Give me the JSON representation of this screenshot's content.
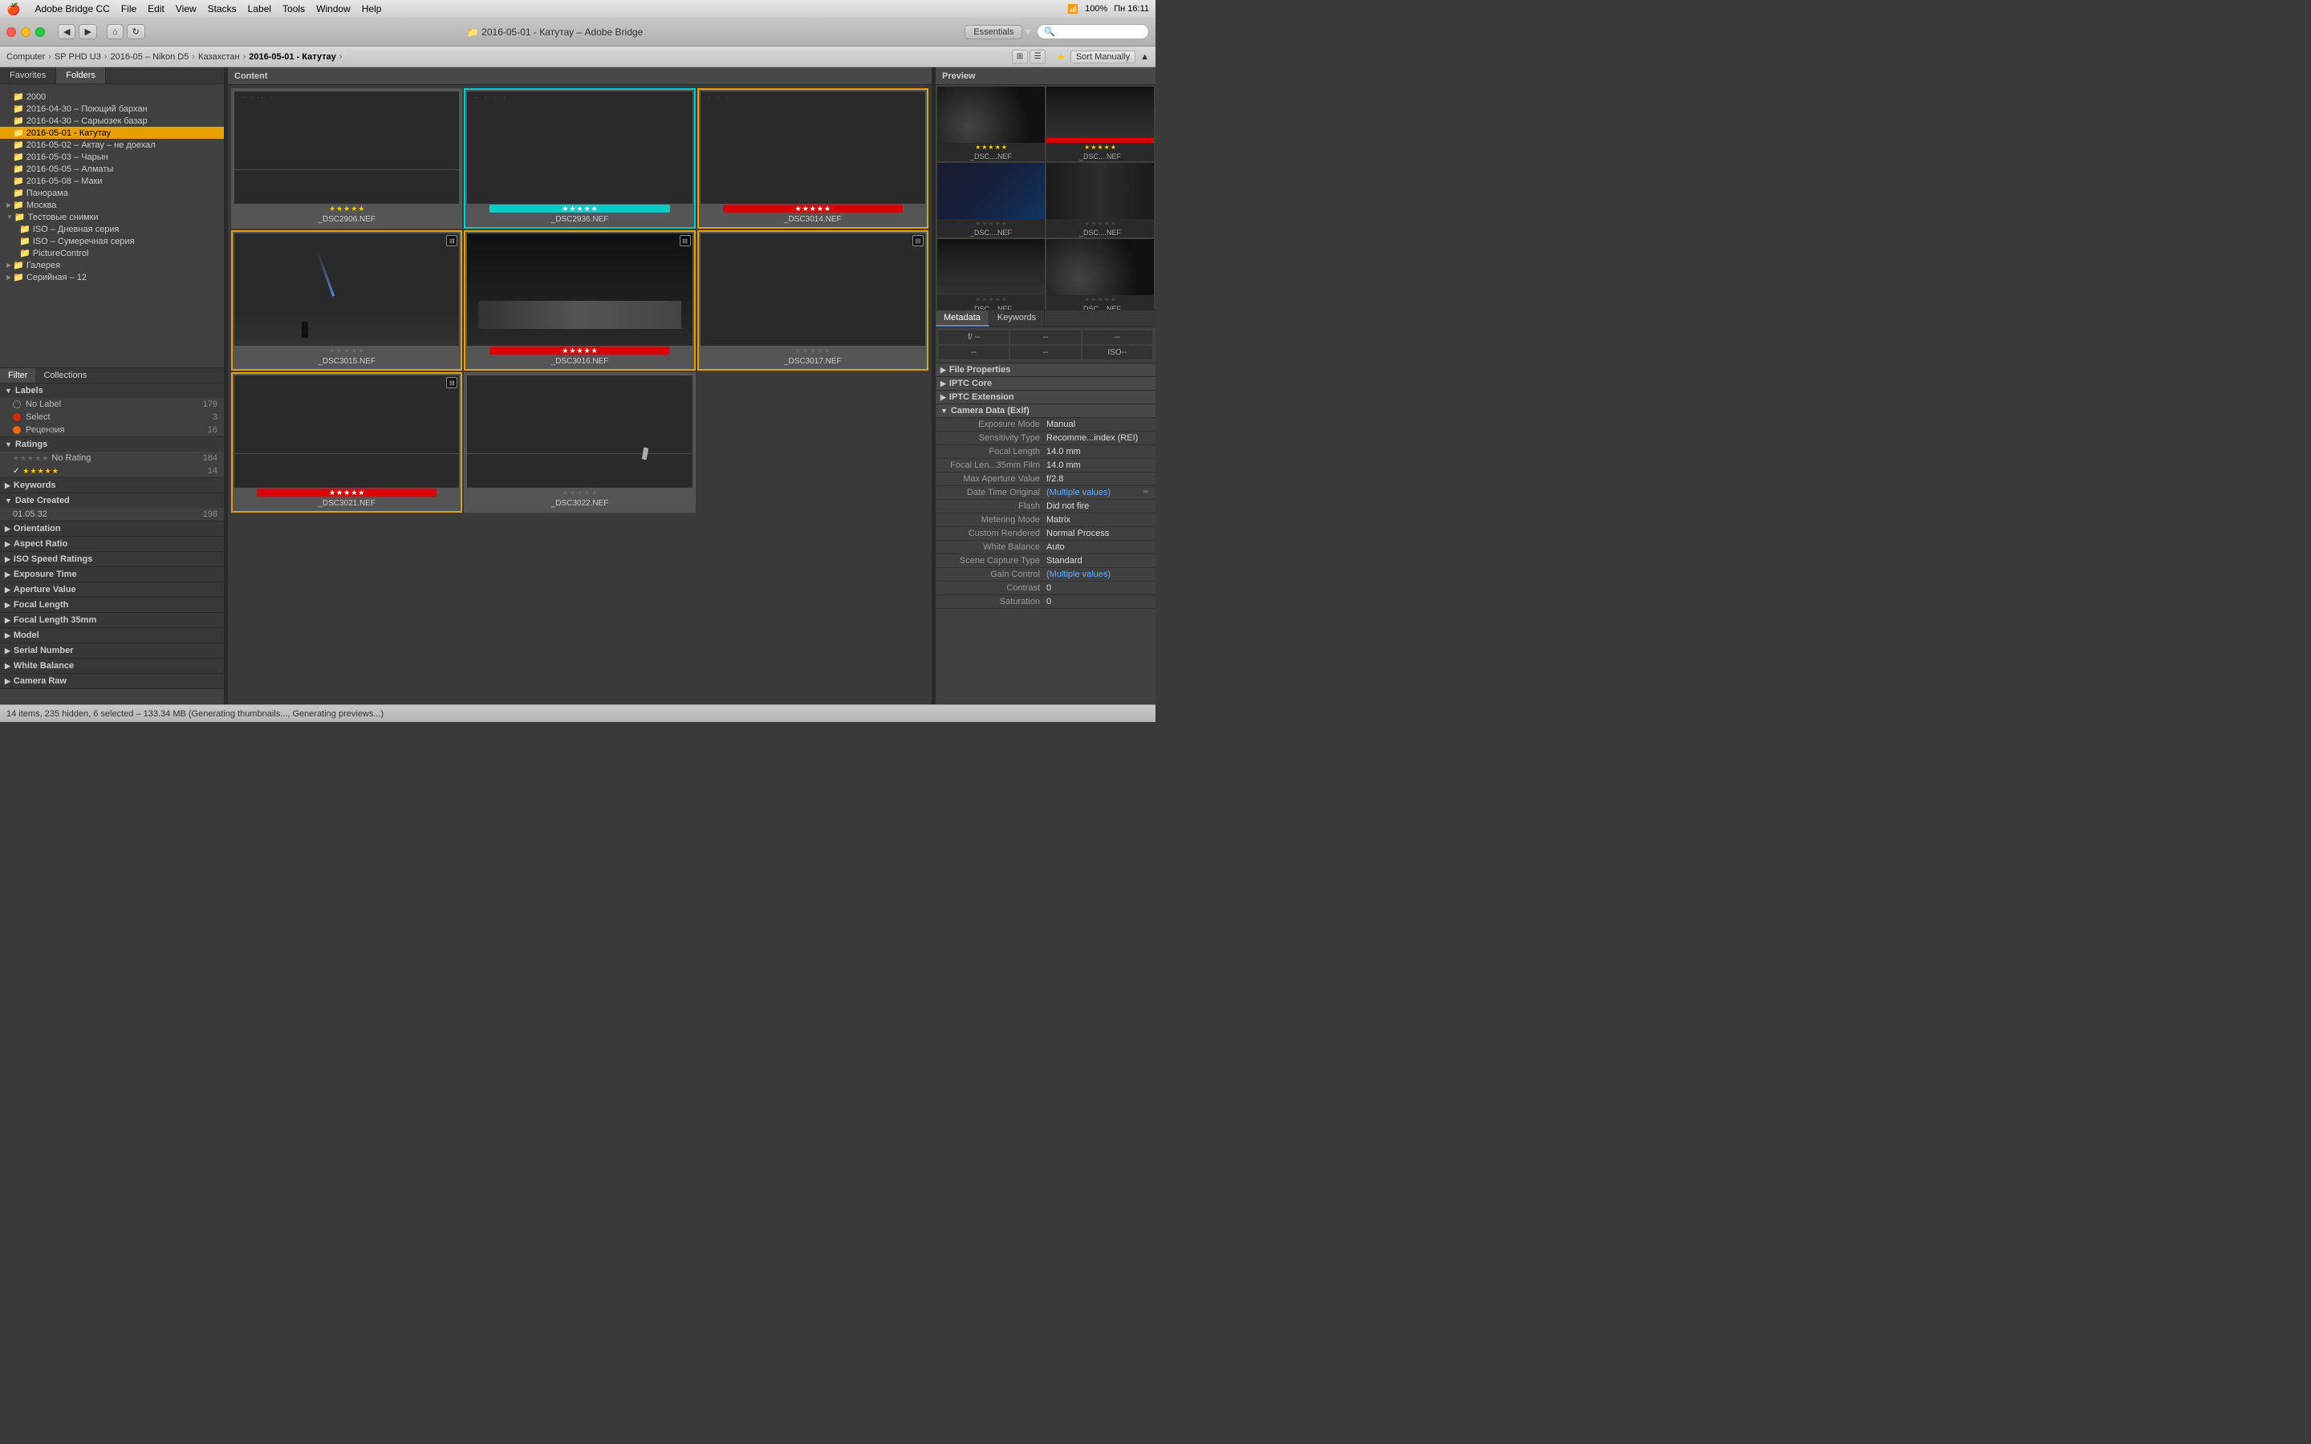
{
  "menubar": {
    "apple": "🍎",
    "app_name": "Adobe Bridge CC",
    "menus": [
      "File",
      "Edit",
      "View",
      "Stacks",
      "Label",
      "Tools",
      "Window",
      "Help"
    ],
    "right": "Пн 16:11",
    "battery": "100%"
  },
  "titlebar": {
    "title": "📁 2016-05-01 - Катутау – Adobe Bridge",
    "back": "◀",
    "forward": "▶"
  },
  "toolbar": {
    "essentials": "Essentials",
    "sort": "Sort Manually"
  },
  "breadcrumb": {
    "items": [
      "Computer",
      "SP PHD U3",
      "2016-05 – Nikon D5",
      "Казахстан",
      "2016-05-01 - Катутау"
    ]
  },
  "panels": {
    "left": {
      "tabs": [
        "Favorites",
        "Folders"
      ],
      "active_tab": "Folders",
      "tree": [
        {
          "label": "2000",
          "indent": 2,
          "icon": "📁"
        },
        {
          "label": "2016-04-30 – Поющий бархан",
          "indent": 2,
          "icon": "📁"
        },
        {
          "label": "2016-04-30 – Сарыозек базар",
          "indent": 2,
          "icon": "📁"
        },
        {
          "label": "2016-05-01 - Катутау",
          "indent": 2,
          "icon": "📁",
          "selected": true
        },
        {
          "label": "2016-05-02 – Актау – не доехал",
          "indent": 2,
          "icon": "📁"
        },
        {
          "label": "2016-05-03 – Чарын",
          "indent": 2,
          "icon": "📁"
        },
        {
          "label": "2016-05-05 – Алматы",
          "indent": 2,
          "icon": "📁"
        },
        {
          "label": "2016-05-08 – Маки",
          "indent": 2,
          "icon": "📁"
        },
        {
          "label": "Панорама",
          "indent": 2,
          "icon": "📁"
        },
        {
          "label": "Москва",
          "indent": 1,
          "icon": "📁"
        },
        {
          "label": "Тестовые снимки",
          "indent": 1,
          "icon": "📁",
          "expanded": true
        },
        {
          "label": "ISO – Дневная серия",
          "indent": 3,
          "icon": "📁"
        },
        {
          "label": "ISO – Сумеречная серия",
          "indent": 3,
          "icon": "📁"
        },
        {
          "label": "PictureControl",
          "indent": 3,
          "icon": "📁"
        },
        {
          "label": "Галерея",
          "indent": 1,
          "icon": "📁"
        },
        {
          "label": "Серийная – 12",
          "indent": 1,
          "icon": "📁"
        }
      ]
    },
    "filter": {
      "tabs": [
        "Filter",
        "Collections"
      ],
      "sections": {
        "labels": {
          "title": "Labels",
          "items": [
            {
              "label": "No Label",
              "count": 179,
              "dot_color": "transparent",
              "dot_border": "1px solid #888"
            },
            {
              "label": "Select",
              "count": 3,
              "dot_color": "#dd2200"
            },
            {
              "label": "Рецензия",
              "count": 16,
              "dot_color": "#ff6600"
            }
          ]
        },
        "ratings": {
          "title": "Ratings",
          "items": [
            {
              "label": "No Rating",
              "count": 184,
              "stars": 0
            },
            {
              "label": "★★★★★",
              "count": 14,
              "stars": 5,
              "checked": true
            }
          ]
        },
        "keywords": {
          "title": "Keywords"
        },
        "date_created": {
          "title": "Date Created",
          "items": [
            {
              "label": "01.05.32",
              "count": 198
            }
          ]
        },
        "orientation": {
          "title": "Orientation"
        },
        "aspect_ratio": {
          "title": "Aspect Ratio"
        },
        "iso_speed": {
          "title": "ISO Speed Ratings"
        },
        "exposure_time": {
          "title": "Exposure Time"
        },
        "aperture": {
          "title": "Aperture Value"
        },
        "focal_length": {
          "title": "Focal Length"
        },
        "focal_35mm": {
          "title": "Focal Length 35mm"
        },
        "model": {
          "title": "Model"
        },
        "serial_number": {
          "title": "Serial Number"
        },
        "white_balance": {
          "title": "White Balance"
        },
        "camera_raw": {
          "title": "Camera Raw"
        }
      }
    }
  },
  "content": {
    "header": "Content",
    "thumbnails": [
      {
        "name": "_DSC2906.NEF",
        "stars": 5,
        "rating_bar": "none",
        "selected": false,
        "has_stack": false,
        "img_type": "dark1"
      },
      {
        "name": "_DSC2936.NEF",
        "stars": 5,
        "rating_bar": "cyan",
        "selected": false,
        "has_stack": false,
        "img_type": "dark2"
      },
      {
        "name": "_DSC3014.NEF",
        "stars": 5,
        "rating_bar": "red",
        "selected": true,
        "has_stack": false,
        "img_type": "dark3"
      },
      {
        "name": "_DSC3015.NEF",
        "stars": 0,
        "rating_bar": "none",
        "selected": true,
        "has_stack": true,
        "img_type": "dark1"
      },
      {
        "name": "_DSC3016.NEF",
        "stars": 5,
        "rating_bar": "red",
        "selected": true,
        "has_stack": false,
        "img_type": "dark2"
      },
      {
        "name": "_DSC3017.NEF",
        "stars": 0,
        "rating_bar": "none",
        "selected": true,
        "has_stack": false,
        "img_type": "dark3"
      },
      {
        "name": "_DSC3021.NEF",
        "stars": 5,
        "rating_bar": "red",
        "selected": true,
        "has_stack": true,
        "img_type": "dark4"
      },
      {
        "name": "_DSC3022.NEF",
        "stars": 0,
        "rating_bar": "none",
        "selected": false,
        "has_stack": false,
        "img_type": "dark1"
      }
    ]
  },
  "preview": {
    "header": "Preview",
    "thumbnails": [
      {
        "name": "_DSC....NEF",
        "stars": 5,
        "has_red": true,
        "img_type": "dark1"
      },
      {
        "name": "_DSC....NEF",
        "stars": 5,
        "has_red": false,
        "img_type": "dark2"
      },
      {
        "name": "_DSC....NEF",
        "stars": 0,
        "has_red": false,
        "img_type": "dark3"
      },
      {
        "name": "_DSC....NEF",
        "stars": 0,
        "has_red": false,
        "img_type": "dark4"
      },
      {
        "name": "_DSC....NEF",
        "stars": 0,
        "has_red": false,
        "img_type": "dark1"
      },
      {
        "name": "_DSC....NEF",
        "stars": 0,
        "has_red": false,
        "img_type": "dark2"
      }
    ]
  },
  "metadata": {
    "tabs": [
      "Metadata",
      "Keywords"
    ],
    "active_tab": "Metadata",
    "exif_summary": {
      "f_label": "f/ --",
      "f_value": "--",
      "exp_label": "--",
      "exp_value": "--",
      "iso_label": "ISO--",
      "iso_value": "--",
      "cell4": "--",
      "cell5": "--",
      "cell6": "--"
    },
    "sections": {
      "file_properties": {
        "label": "File Properties"
      },
      "iptc_core": {
        "label": "IPTC Core"
      },
      "iptc_extension": {
        "label": "IPTC Extension"
      },
      "camera_data": {
        "label": "Camera Data (Exif)",
        "rows": [
          {
            "label": "Exposure Mode",
            "value": "Manual"
          },
          {
            "label": "Sensitivity Type",
            "value": "Recomme...index (REI)"
          },
          {
            "label": "Focal Length",
            "value": "14.0 mm"
          },
          {
            "label": "Focal Len...35mm Film",
            "value": "14.0 mm"
          },
          {
            "label": "Max Aperture Value",
            "value": "f/2.8"
          },
          {
            "label": "Date Time Original",
            "value": "(Multiple values)",
            "editable": true
          },
          {
            "label": "Flash",
            "value": "Did not fire"
          },
          {
            "label": "Metering Mode",
            "value": "Matrix"
          },
          {
            "label": "Custom Rendered",
            "value": "Normal Process"
          },
          {
            "label": "White Balance",
            "value": "Auto"
          },
          {
            "label": "Scene Capture Type",
            "value": "Standard"
          },
          {
            "label": "Gain Control",
            "value": "(Multiple values)"
          },
          {
            "label": "Contrast",
            "value": "0"
          },
          {
            "label": "Saturation",
            "value": "0"
          }
        ]
      }
    }
  },
  "statusbar": {
    "text": "14 items, 235 hidden, 6 selected – 133.34 MB (Generating thumbnails..., Generating previews...)"
  }
}
